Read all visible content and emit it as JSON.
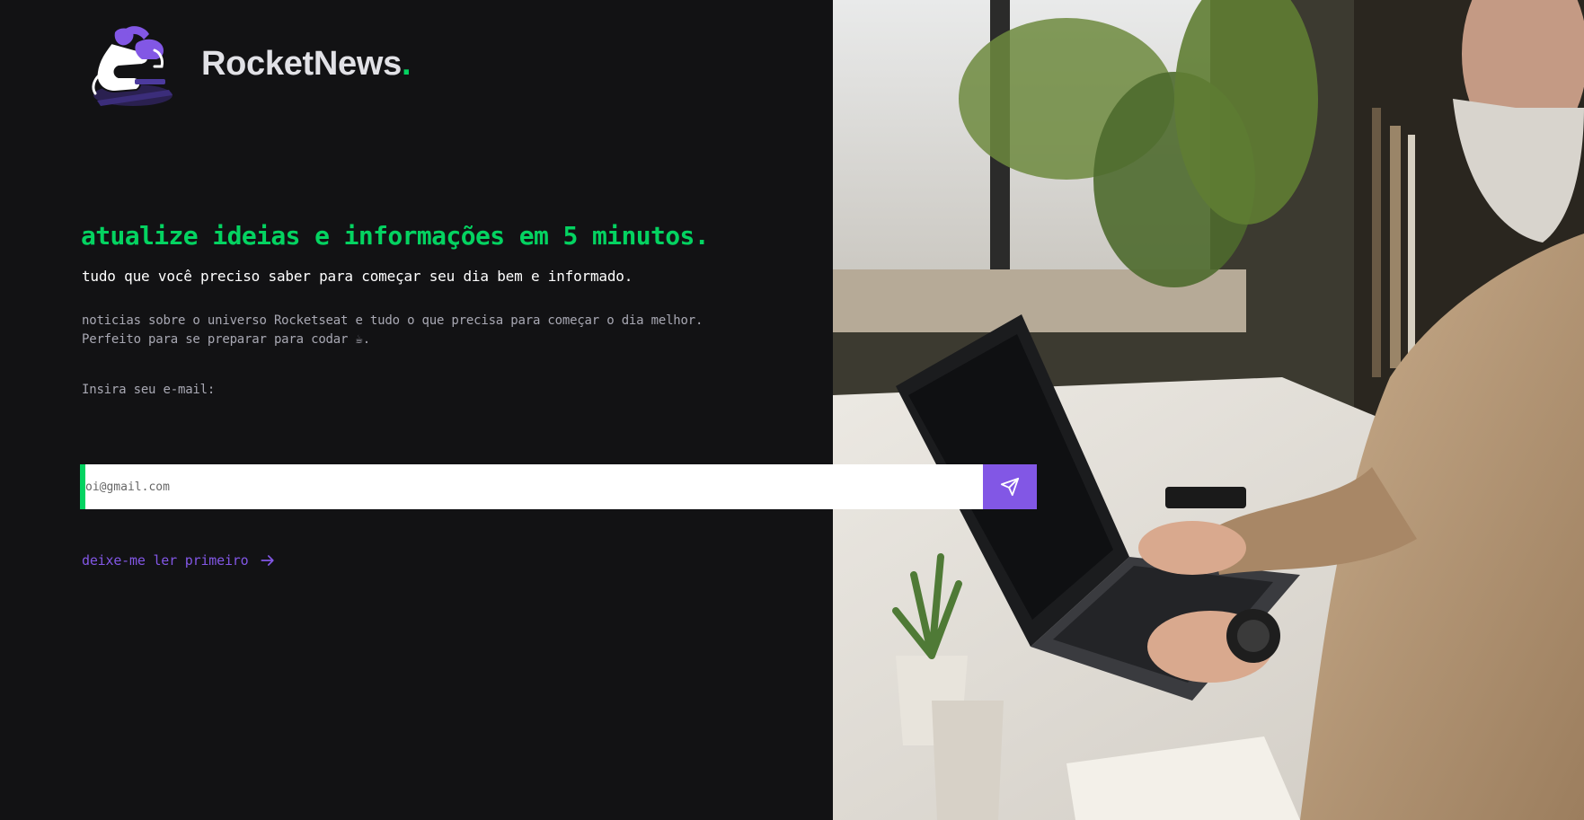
{
  "brand": {
    "name": "RocketNews",
    "dot": "."
  },
  "hero": {
    "headline": "atualize ideias e informações em 5 minutos.",
    "subheadline": "tudo que você preciso saber para começar seu dia bem e informado.",
    "description_line1": "noticias sobre o universo Rocketseat e tudo o que precisa para começar o dia melhor.",
    "description_line2": "Perfeito para se preparar para codar ☕."
  },
  "form": {
    "email_label": "Insira seu e-mail:",
    "email_placeholder": "oi@gmail.com",
    "email_value": ""
  },
  "links": {
    "read_first": "deixe-me ler primeiro"
  },
  "icons": {
    "logo": "developer-illustration-logo",
    "send": "send-icon",
    "arrow": "arrow-right-icon"
  },
  "colors": {
    "background": "#121214",
    "accent_green": "#04d361",
    "accent_purple": "#8257e5",
    "text_light": "#e1e1e6",
    "text_muted": "#a8a8b3"
  }
}
